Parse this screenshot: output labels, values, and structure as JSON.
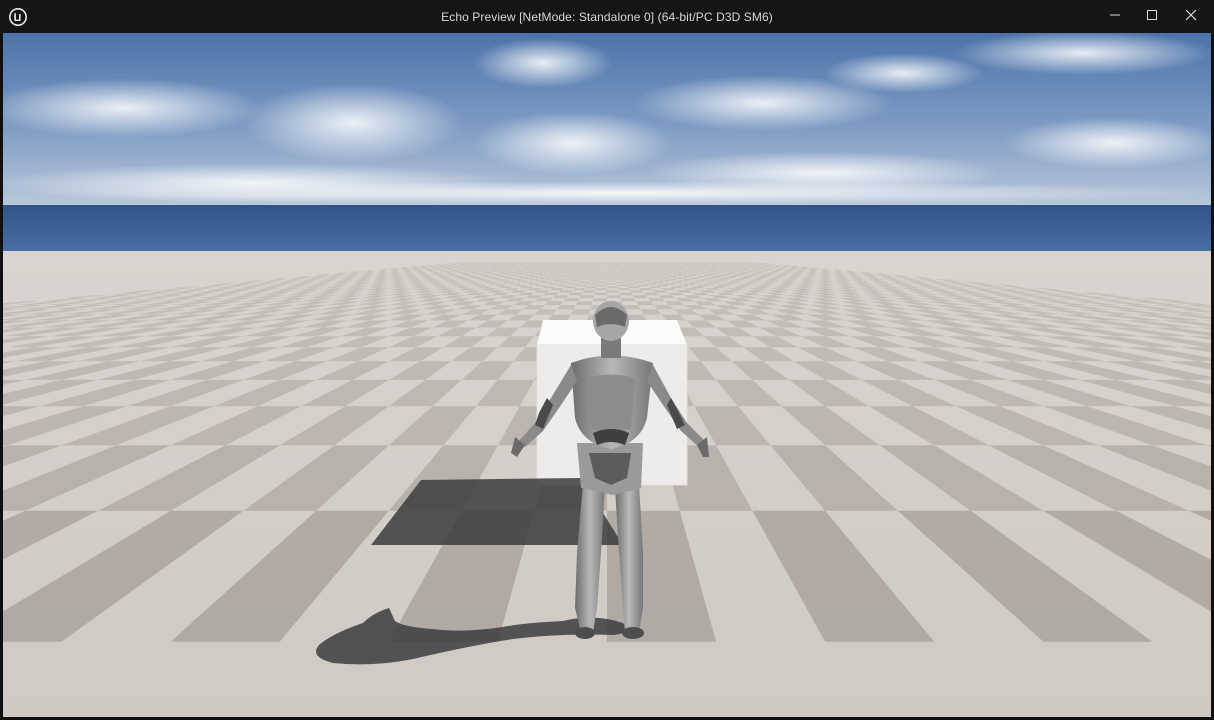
{
  "window": {
    "title": "Echo Preview [NetMode: Standalone 0]  (64-bit/PC D3D SM6)",
    "app_icon": "unreal-engine-logo",
    "controls": {
      "minimize_icon": "minimize-icon",
      "maximize_icon": "maximize-icon",
      "close_icon": "close-icon"
    }
  },
  "viewport": {
    "scene": "game-viewport",
    "colors": {
      "sky_top": "#4f76ab",
      "sky_horizon": "#b7c6da",
      "ocean": "#3a5f93",
      "floor_light": "#d8d2cc",
      "floor_dark": "#a8a19b",
      "cube": "#f2f0ee",
      "character": "#9a9a9a"
    }
  }
}
